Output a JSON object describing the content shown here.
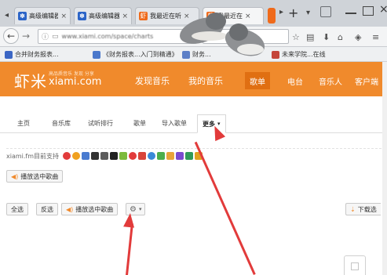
{
  "browser": {
    "tabs": [
      {
        "label": "高级编辑器",
        "icon": "baidu-paw-icon",
        "active": false
      },
      {
        "label": "高级编辑器",
        "icon": "baidu-paw-icon",
        "active": false
      },
      {
        "label": "我最近在听",
        "icon": "xiami-icon",
        "active": false
      },
      {
        "label": "我最近在",
        "icon": "xiami-icon",
        "active": true
      }
    ],
    "new_tab_label": "+",
    "url": "www.xiami.com/space/charts",
    "bookmarks": [
      {
        "label": "合并财务报表..."
      },
      {
        "label": "《财务报表...入门到精通》"
      },
      {
        "label": "财务..."
      },
      {
        "label": "未来学院...在线"
      }
    ]
  },
  "site": {
    "logo": "虾米",
    "logo_tagline": "高品质音乐 发现 分享",
    "logo_domain": "xiami.com",
    "nav": {
      "discover": "发现音乐",
      "my_music": "我的音乐",
      "right": [
        "歌单",
        "电台",
        "音乐人",
        "客户端"
      ]
    },
    "subnav": {
      "items": [
        "主页",
        "音乐库",
        "试听排行",
        "歌单",
        "导入歌单"
      ],
      "more": "更多"
    },
    "support_text": "xiami.fm目前支持",
    "play_selected": "播放选中歌曲",
    "toolbar": {
      "select_all": "全选",
      "invert": "反选",
      "play_selected": "播放选中歌曲",
      "download": "下载选"
    }
  },
  "colors": {
    "brand_orange": "#f08a2c",
    "annotation_arrow": "#e23b3b"
  }
}
